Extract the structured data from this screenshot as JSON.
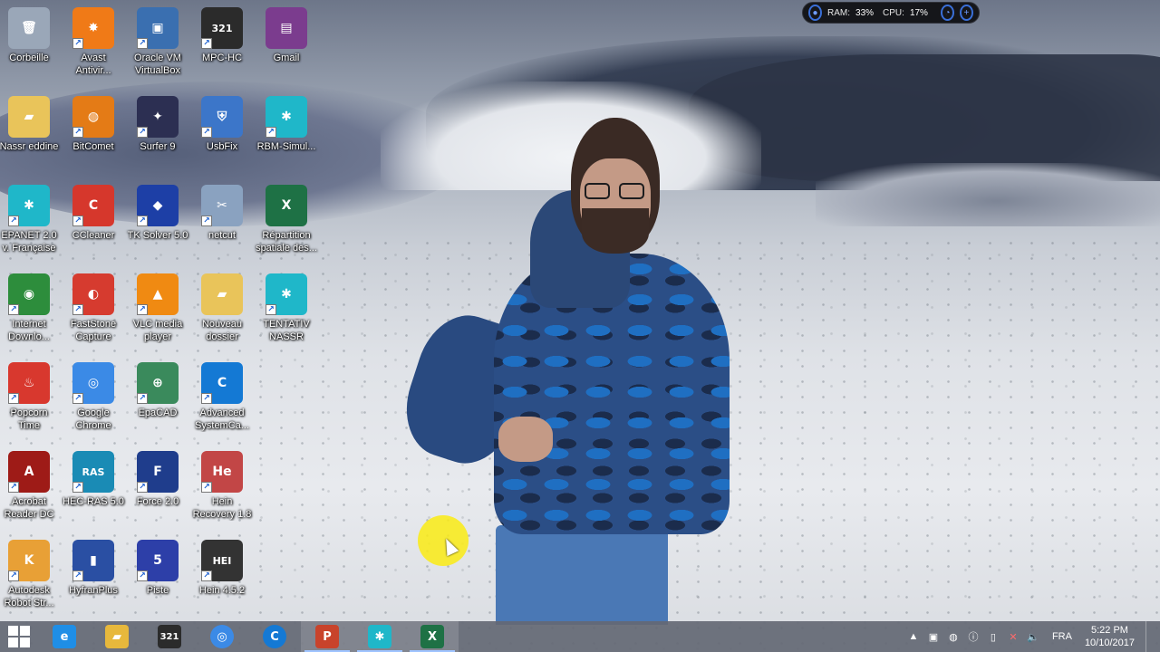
{
  "desktop": {
    "icons": [
      {
        "label": "Corbeille",
        "icon": "recycle-bin-icon",
        "color": "#9aa7b8",
        "glyph": "🗑",
        "shortcut": false
      },
      {
        "label": "Avast\nAntivir...",
        "icon": "avast-icon",
        "color": "#f07a17",
        "glyph": "✸",
        "shortcut": true
      },
      {
        "label": "Oracle VM\nVirtualBox",
        "icon": "virtualbox-icon",
        "color": "#3a6fb0",
        "glyph": "▣",
        "shortcut": true
      },
      {
        "label": "MPC-HC",
        "icon": "mpc-hc-icon",
        "color": "#2b2b2b",
        "glyph": "321",
        "shortcut": true
      },
      {
        "label": "Gmail",
        "icon": "winrar-archive-icon",
        "color": "#7b3c8e",
        "glyph": "▤",
        "shortcut": false
      },
      {
        "label": "Nassr eddine",
        "icon": "pdf-folder-icon",
        "color": "#e9c45a",
        "glyph": "▰",
        "shortcut": false
      },
      {
        "label": "BitComet",
        "icon": "bitcomet-icon",
        "color": "#e47b16",
        "glyph": "◍",
        "shortcut": true
      },
      {
        "label": "Surfer 9",
        "icon": "surfer-icon",
        "color": "#2c2f52",
        "glyph": "✦",
        "shortcut": true
      },
      {
        "label": "UsbFix",
        "icon": "usbfix-icon",
        "color": "#3c76c9",
        "glyph": "⛨",
        "shortcut": true
      },
      {
        "label": "RBM-Simul...",
        "icon": "rbm-simul-icon",
        "color": "#1fb7c9",
        "glyph": "✱",
        "shortcut": true
      },
      {
        "label": "EPANET 2.0\nv. Française",
        "icon": "epanet-icon",
        "color": "#1fb7c9",
        "glyph": "✱",
        "shortcut": true
      },
      {
        "label": "CCleaner",
        "icon": "ccleaner-icon",
        "color": "#d6372c",
        "glyph": "C",
        "shortcut": true
      },
      {
        "label": "TK Solver 5.0",
        "icon": "tk-solver-icon",
        "color": "#1d3fa6",
        "glyph": "◆",
        "shortcut": true
      },
      {
        "label": "netcut",
        "icon": "netcut-icon",
        "color": "#8aa2c0",
        "glyph": "✂",
        "shortcut": true
      },
      {
        "label": "Répartition\nspatiale des...",
        "icon": "excel-file-icon",
        "color": "#1e7145",
        "glyph": "X",
        "shortcut": false
      },
      {
        "label": "Internet\nDownlo...",
        "icon": "internet-download-manager-icon",
        "color": "#2d8d3c",
        "glyph": "◉",
        "shortcut": true
      },
      {
        "label": "FastStone\nCapture",
        "icon": "faststone-capture-icon",
        "color": "#d63b2f",
        "glyph": "◐",
        "shortcut": true
      },
      {
        "label": "VLC media\nplayer",
        "icon": "vlc-icon",
        "color": "#f08a12",
        "glyph": "▲",
        "shortcut": true
      },
      {
        "label": "Nouveau\ndossier",
        "icon": "folder-icon",
        "color": "#e9c45a",
        "glyph": "▰",
        "shortcut": false
      },
      {
        "label": "TENTATIV\nNASSR",
        "icon": "tentativ-icon",
        "color": "#1fb7c9",
        "glyph": "✱",
        "shortcut": true
      },
      {
        "label": "Popcorn\nTime",
        "icon": "popcorn-time-icon",
        "color": "#d8382e",
        "glyph": "♨",
        "shortcut": true
      },
      {
        "label": "Google\nChrome",
        "icon": "chrome-icon",
        "color": "#3b8ae6",
        "glyph": "◎",
        "shortcut": true
      },
      {
        "label": "EpaCAD",
        "icon": "epacad-icon",
        "color": "#3a8a5c",
        "glyph": "⊕",
        "shortcut": true
      },
      {
        "label": "Advanced\nSystemCa...",
        "icon": "advanced-systemcare-icon",
        "color": "#1479d4",
        "glyph": "C",
        "shortcut": true
      },
      {
        "label": "Acrobat\nReader DC",
        "icon": "acrobat-reader-icon",
        "color": "#9e1b17",
        "glyph": "A",
        "shortcut": true
      },
      {
        "label": "HEC-RAS 5.0",
        "icon": "hec-ras-icon",
        "color": "#1a8bb5",
        "glyph": "RAS",
        "shortcut": true
      },
      {
        "label": "Force 2.0",
        "icon": "force-icon",
        "color": "#1f3d8c",
        "glyph": "F",
        "shortcut": true
      },
      {
        "label": "Hein\nRecovery 1.8",
        "icon": "hein-recovery-icon",
        "color": "#c24646",
        "glyph": "He",
        "shortcut": true
      },
      {
        "label": "Autodesk\nRobot Str...",
        "icon": "autodesk-robot-icon",
        "color": "#e8a036",
        "glyph": "K",
        "shortcut": true
      },
      {
        "label": "HyfranPlus",
        "icon": "hyfranplus-icon",
        "color": "#2a4fa3",
        "glyph": "▮",
        "shortcut": true
      },
      {
        "label": "Piste",
        "icon": "piste-icon",
        "color": "#2d3fa8",
        "glyph": "5",
        "shortcut": true
      },
      {
        "label": "Hein 4.5.2",
        "icon": "hein-icon",
        "color": "#333333",
        "glyph": "HEI",
        "shortcut": true
      }
    ]
  },
  "monitor": {
    "ram_label": "RAM:",
    "ram_value": "33%",
    "cpu_label": "CPU:",
    "cpu_value": "17%"
  },
  "taskbar": {
    "apps": [
      {
        "name": "internet-explorer",
        "glyph": "e",
        "color": "#1f8ee6",
        "active": false
      },
      {
        "name": "file-explorer",
        "glyph": "▰",
        "color": "#e7b83c",
        "active": false
      },
      {
        "name": "mpc-hc",
        "glyph": "321",
        "color": "#2b2b2b",
        "active": false
      },
      {
        "name": "chrome",
        "glyph": "◎",
        "color": "#3b8ae6",
        "active": false
      },
      {
        "name": "advanced-systemcare",
        "glyph": "C",
        "color": "#1479d4",
        "active": false
      },
      {
        "name": "powerpoint",
        "glyph": "P",
        "color": "#c8432b",
        "active": true
      },
      {
        "name": "rbm-simul",
        "glyph": "✱",
        "color": "#1fb7c9",
        "active": true
      },
      {
        "name": "excel",
        "glyph": "X",
        "color": "#1e7145",
        "active": true
      }
    ],
    "language": "FRA",
    "time": "5:22 PM",
    "date": "10/10/2017"
  }
}
